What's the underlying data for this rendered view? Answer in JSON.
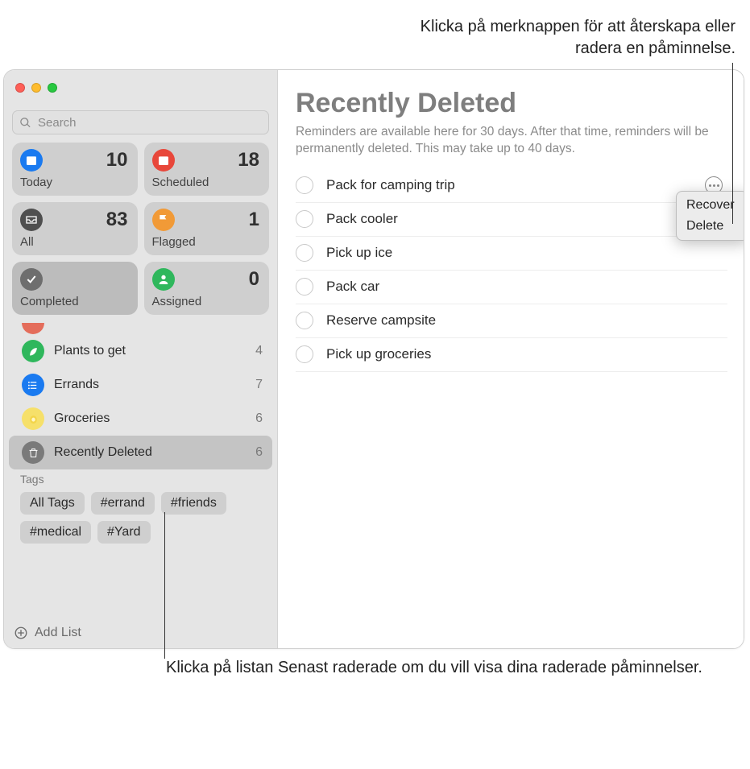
{
  "callouts": {
    "top": "Klicka på merknappen för att återskapa eller radera en påminnelse.",
    "bottom": "Klicka på listan Senast raderade om du vill visa dina raderade påminnelser."
  },
  "traffic_colors": {
    "close": "#ff5f57",
    "min": "#febc2e",
    "max": "#28c840"
  },
  "search": {
    "placeholder": "Search"
  },
  "smart": [
    {
      "key": "today",
      "label": "Today",
      "count": 10,
      "color": "#1a7af0",
      "icon": "calendar"
    },
    {
      "key": "scheduled",
      "label": "Scheduled",
      "count": 18,
      "color": "#e8473a",
      "icon": "calendar"
    },
    {
      "key": "all",
      "label": "All",
      "count": 83,
      "color": "#4f4f4f",
      "icon": "tray"
    },
    {
      "key": "flagged",
      "label": "Flagged",
      "count": 1,
      "color": "#f19a37",
      "icon": "flag"
    },
    {
      "key": "completed",
      "label": "Completed",
      "count": "",
      "color": "#6e6e6e",
      "icon": "check"
    },
    {
      "key": "assigned",
      "label": "Assigned",
      "count": 0,
      "color": "#2fb75c",
      "icon": "person"
    }
  ],
  "lists": [
    {
      "label": "Plants to get",
      "count": 4,
      "color": "#2fb75c",
      "icon": "leaf",
      "selected": false
    },
    {
      "label": "Errands",
      "count": 7,
      "color": "#1a7af0",
      "icon": "list",
      "selected": false
    },
    {
      "label": "Groceries",
      "count": 6,
      "color": "#f6e06a",
      "icon": "lemon",
      "selected": false
    },
    {
      "label": "Recently Deleted",
      "count": 6,
      "color": "#7a7a7a",
      "icon": "trash",
      "selected": true
    }
  ],
  "tags_header": "Tags",
  "tags": [
    "All Tags",
    "#errand",
    "#friends",
    "#medical",
    "#Yard"
  ],
  "add_list_label": "Add List",
  "main": {
    "title": "Recently Deleted",
    "description": "Reminders are available here for 30 days. After that time, reminders will be permanently deleted. This may take up to 40 days.",
    "items": [
      "Pack for camping trip",
      "Pack cooler",
      "Pick up ice",
      "Pack car",
      "Reserve campsite",
      "Pick up groceries"
    ],
    "popup": {
      "recover": "Recover",
      "delete": "Delete"
    }
  }
}
